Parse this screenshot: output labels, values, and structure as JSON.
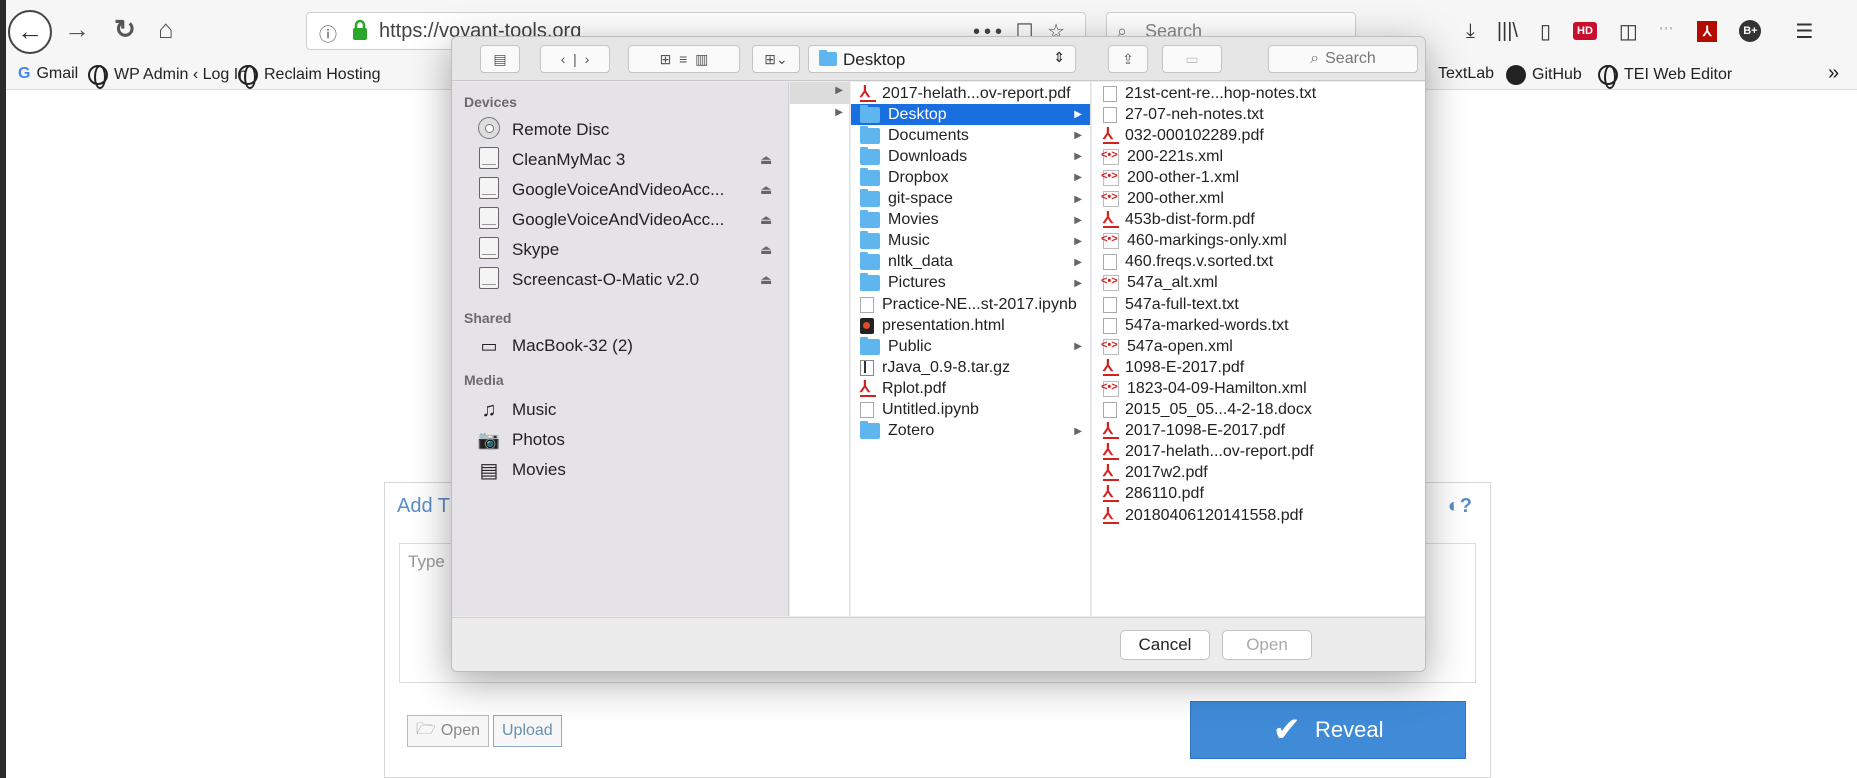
{
  "browser": {
    "url_info_icon": "info-icon",
    "url": "https://voyant-tools.org",
    "url_actions": "••• ☐ ☆",
    "search_placeholder": "Search",
    "bookmarks": [
      {
        "label": "Gmail",
        "icon": "gmail-icon"
      },
      {
        "label": "WP Admin ‹ Log In",
        "icon": "globe-icon"
      },
      {
        "label": "Reclaim Hosting",
        "icon": "globe-icon"
      },
      {
        "label": "TextLab",
        "icon": ""
      },
      {
        "label": "GitHub",
        "icon": "github-icon"
      },
      {
        "label": "TEI Web Editor",
        "icon": "globe-icon"
      }
    ],
    "more": "»"
  },
  "page": {
    "panel_title": "Add T",
    "textarea_placeholder": "Type",
    "open_label": "Open",
    "upload_label": "Upload",
    "reveal_label": "Reveal",
    "accent": "#3f8bd8"
  },
  "dialog": {
    "location": "Desktop",
    "search_label": "Search",
    "sidebar": {
      "devices_header": "Devices",
      "devices": [
        {
          "label": "Remote Disc",
          "icon": "disc-icon",
          "eject": false
        },
        {
          "label": "CleanMyMac 3",
          "icon": "drive-icon",
          "eject": true
        },
        {
          "label": "GoogleVoiceAndVideoAcc...",
          "icon": "drive-icon",
          "eject": true
        },
        {
          "label": "GoogleVoiceAndVideoAcc...",
          "icon": "drive-icon",
          "eject": true
        },
        {
          "label": "Skype",
          "icon": "drive-icon",
          "eject": true
        },
        {
          "label": "Screencast-O-Matic v2.0",
          "icon": "drive-icon",
          "eject": true
        }
      ],
      "shared_header": "Shared",
      "shared": [
        {
          "label": "MacBook-32 (2)",
          "icon": "laptop-icon"
        }
      ],
      "media_header": "Media",
      "media": [
        {
          "label": "Music",
          "icon": "music-icon"
        },
        {
          "label": "Photos",
          "icon": "camera-icon"
        },
        {
          "label": "Movies",
          "icon": "film-icon"
        }
      ]
    },
    "column2": [
      {
        "label": "2017-helath...ov-report.pdf",
        "type": "pdf",
        "arrow": false
      },
      {
        "label": "Desktop",
        "type": "folder",
        "arrow": true,
        "selected": true
      },
      {
        "label": "Documents",
        "type": "folder",
        "arrow": true
      },
      {
        "label": "Downloads",
        "type": "folder",
        "arrow": true
      },
      {
        "label": "Dropbox",
        "type": "folder",
        "arrow": true
      },
      {
        "label": "git-space",
        "type": "folder",
        "arrow": true
      },
      {
        "label": "Movies",
        "type": "folder",
        "arrow": true
      },
      {
        "label": "Music",
        "type": "folder",
        "arrow": true
      },
      {
        "label": "nltk_data",
        "type": "folder",
        "arrow": true
      },
      {
        "label": "Pictures",
        "type": "folder",
        "arrow": true
      },
      {
        "label": "Practice-NE...st-2017.ipynb",
        "type": "doc",
        "arrow": false
      },
      {
        "label": "presentation.html",
        "type": "html",
        "arrow": false
      },
      {
        "label": "Public",
        "type": "folder",
        "arrow": true
      },
      {
        "label": "rJava_0.9-8.tar.gz",
        "type": "arch",
        "arrow": false
      },
      {
        "label": "Rplot.pdf",
        "type": "pdf",
        "arrow": false
      },
      {
        "label": "Untitled.ipynb",
        "type": "doc",
        "arrow": false
      },
      {
        "label": "Zotero",
        "type": "folder",
        "arrow": true
      }
    ],
    "column3": [
      {
        "label": "21st-cent-re...hop-notes.txt",
        "type": "doc"
      },
      {
        "label": "27-07-neh-notes.txt",
        "type": "doc"
      },
      {
        "label": "032-000102289.pdf",
        "type": "pdf"
      },
      {
        "label": "200-221s.xml",
        "type": "xml"
      },
      {
        "label": "200-other-1.xml",
        "type": "xml"
      },
      {
        "label": "200-other.xml",
        "type": "xml"
      },
      {
        "label": "453b-dist-form.pdf",
        "type": "pdf"
      },
      {
        "label": "460-markings-only.xml",
        "type": "xml"
      },
      {
        "label": "460.freqs.v.sorted.txt",
        "type": "doc"
      },
      {
        "label": "547a_alt.xml",
        "type": "xml"
      },
      {
        "label": "547a-full-text.txt",
        "type": "doc"
      },
      {
        "label": "547a-marked-words.txt",
        "type": "doc"
      },
      {
        "label": "547a-open.xml",
        "type": "xml"
      },
      {
        "label": "1098-E-2017.pdf",
        "type": "pdf"
      },
      {
        "label": "1823-04-09-Hamilton.xml",
        "type": "xml"
      },
      {
        "label": "2015_05_05...4-2-18.docx",
        "type": "doc"
      },
      {
        "label": "2017-1098-E-2017.pdf",
        "type": "pdf"
      },
      {
        "label": "2017-helath...ov-report.pdf",
        "type": "pdf"
      },
      {
        "label": "2017w2.pdf",
        "type": "pdf"
      },
      {
        "label": "286110.pdf",
        "type": "pdf"
      },
      {
        "label": "20180406120141558.pdf",
        "type": "pdf"
      }
    ],
    "cancel_label": "Cancel",
    "open_label": "Open",
    "selection_color": "#1a6fe0"
  }
}
